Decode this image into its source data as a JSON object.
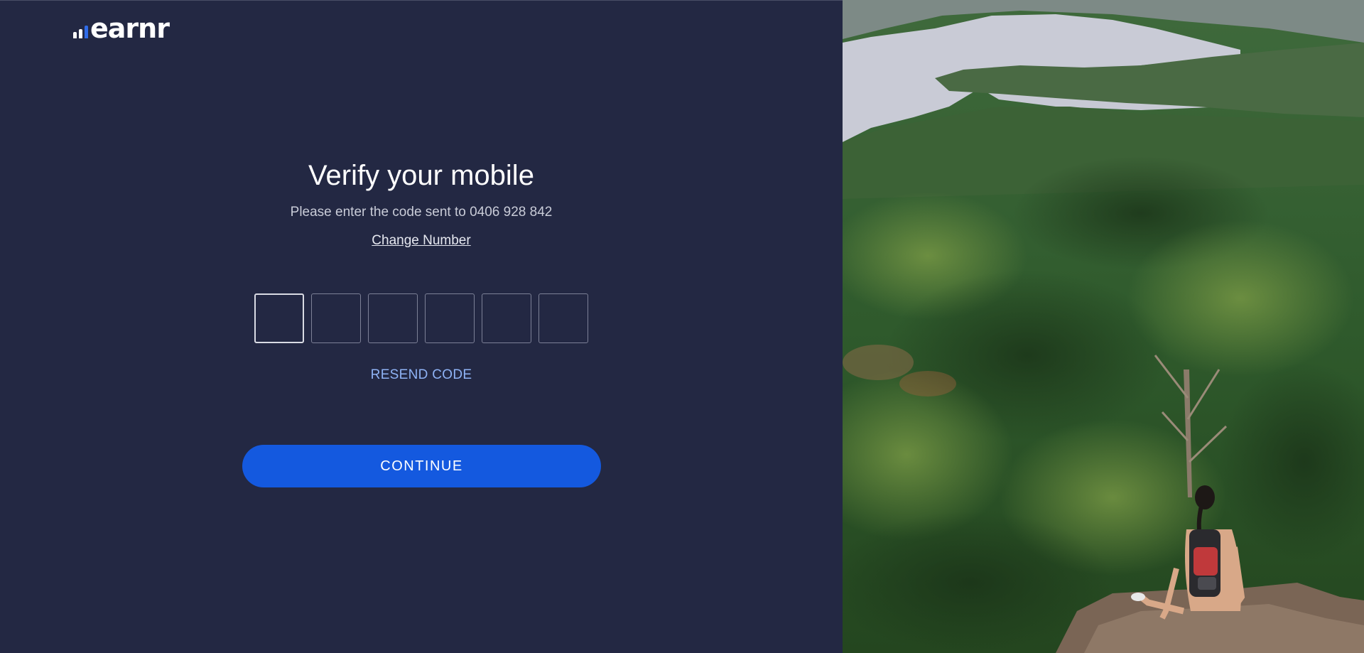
{
  "brand": {
    "name": "earnr",
    "colors": {
      "background": "#232843",
      "accent": "#1459df",
      "link": "#8fb3f5"
    }
  },
  "verify": {
    "title": "Verify your mobile",
    "subtitle": "Please enter the code sent to 0406 928 842",
    "change_number": "Change Number",
    "code_digits": [
      "",
      "",
      "",
      "",
      "",
      ""
    ],
    "resend": "RESEND CODE",
    "continue": "CONTINUE"
  },
  "photo": {
    "description_icon": "landscape-photo"
  }
}
